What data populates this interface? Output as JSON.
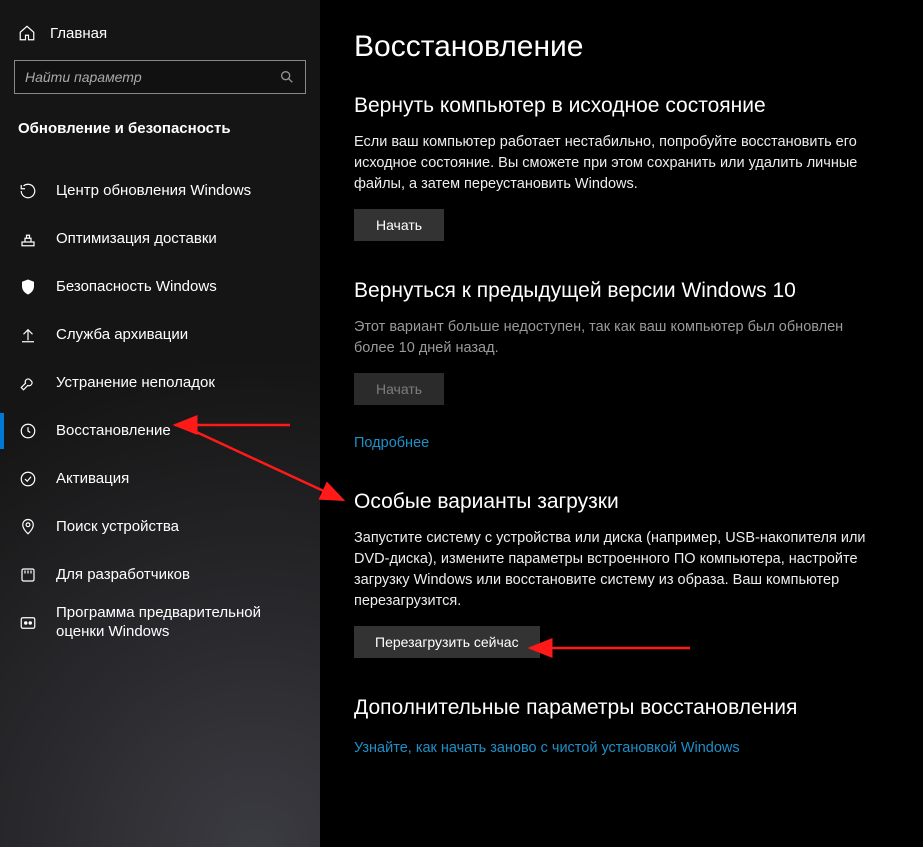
{
  "sidebar": {
    "home_label": "Главная",
    "search_placeholder": "Найти параметр",
    "section_title": "Обновление и безопасность",
    "items": [
      {
        "label": "Центр обновления Windows"
      },
      {
        "label": "Оптимизация доставки"
      },
      {
        "label": "Безопасность Windows"
      },
      {
        "label": "Служба архивации"
      },
      {
        "label": "Устранение неполадок"
      },
      {
        "label": "Восстановление"
      },
      {
        "label": "Активация"
      },
      {
        "label": "Поиск устройства"
      },
      {
        "label": "Для разработчиков"
      },
      {
        "label": "Программа предварительной оценки Windows"
      }
    ]
  },
  "main": {
    "page_title": "Восстановление",
    "reset": {
      "heading": "Вернуть компьютер в исходное состояние",
      "body": "Если ваш компьютер работает нестабильно, попробуйте восстановить его исходное состояние. Вы сможете при этом сохранить или удалить личные файлы, а затем переустановить Windows.",
      "button": "Начать"
    },
    "previous": {
      "heading": "Вернуться к предыдущей версии Windows 10",
      "body": "Этот вариант больше недоступен, так как ваш компьютер был обновлен более 10 дней назад.",
      "button": "Начать",
      "more_link": "Подробнее"
    },
    "advanced": {
      "heading": "Особые варианты загрузки",
      "body": "Запустите систему с устройства или диска (например, USB-накопителя или DVD-диска), измените параметры встроенного ПО компьютера, настройте загрузку Windows или восстановите систему из образа. Ваш компьютер перезагрузится.",
      "button": "Перезагрузить сейчас"
    },
    "more": {
      "heading": "Дополнительные параметры восстановления",
      "link": "Узнайте, как начать заново с чистой установкой Windows"
    }
  }
}
